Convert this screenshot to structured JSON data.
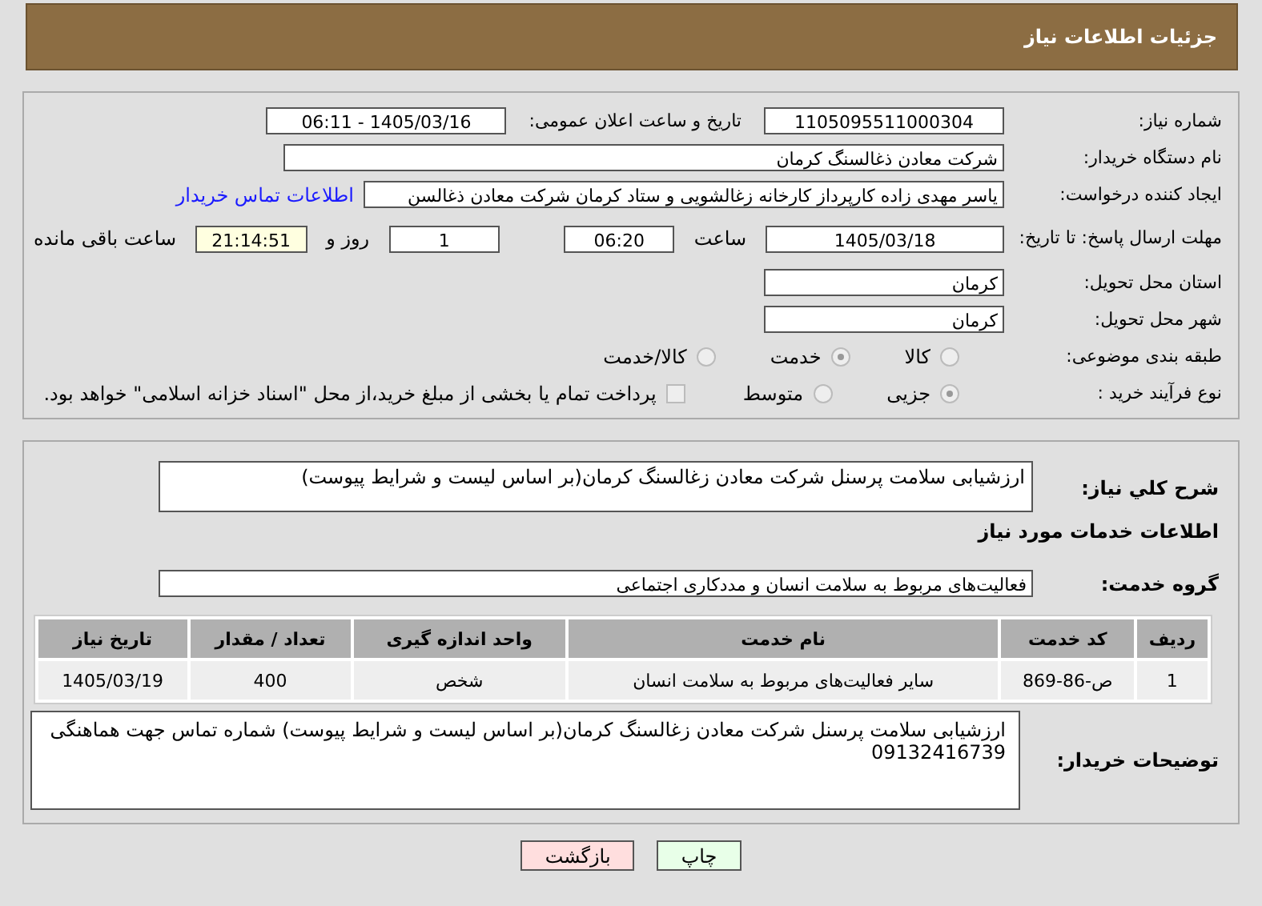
{
  "header": {
    "title": "جزئیات اطلاعات نیاز"
  },
  "details": {
    "need_number": {
      "label": "شماره نیاز:",
      "value": "1105095511000304"
    },
    "announce": {
      "label": "تاریخ و ساعت اعلان عمومی:",
      "value": "1405/03/16 - 06:11"
    },
    "buyer": {
      "label": "نام دستگاه خریدار:",
      "value": "شرکت معادن ذغالسنگ کرمان"
    },
    "creator": {
      "label": "ایجاد کننده درخواست:",
      "value": "یاسر مهدی زاده کارپرداز کارخانه زغالشویی و ستاد کرمان شرکت معادن ذغالسن",
      "link": "اطلاعات تماس خریدار"
    },
    "deadline": {
      "label": "مهلت ارسال پاسخ: تا تاریخ:",
      "date": "1405/03/18",
      "time_label": "ساعت",
      "time": "06:20",
      "days": "1",
      "days_label": "روز و",
      "remaining": "21:14:51",
      "remaining_label": "ساعت باقی مانده"
    },
    "province": {
      "label": "استان محل تحویل:",
      "value": "کرمان"
    },
    "city": {
      "label": "شهر محل تحویل:",
      "value": "کرمان"
    },
    "category": {
      "label": "طبقه بندی موضوعی:",
      "options": [
        {
          "label": "کالا",
          "selected": false
        },
        {
          "label": "خدمت",
          "selected": true
        },
        {
          "label": "کالا/خدمت",
          "selected": false
        }
      ]
    },
    "process": {
      "label": "نوع فرآیند خرید :",
      "options": [
        {
          "label": "جزیی",
          "selected": true
        },
        {
          "label": "متوسط",
          "selected": false
        }
      ],
      "payment": {
        "checked": false,
        "text": "پرداخت تمام یا بخشی از مبلغ خرید،از محل \"اسناد خزانه اسلامی\" خواهد بود."
      }
    }
  },
  "need": {
    "description_label": "شرح کلي نياز:",
    "description": "ارزشیابی سلامت پرسنل شرکت معادن زغالسنگ کرمان(بر اساس لیست و شرایط پیوست)",
    "services_title": "اطلاعات خدمات مورد نیاز",
    "group_label": "گروه خدمت:",
    "group": "فعالیت‌های مربوط به سلامت انسان و مددکاری اجتماعی",
    "table": {
      "columns": [
        "ردیف",
        "کد خدمت",
        "نام خدمت",
        "واحد اندازه گیری",
        "تعداد / مقدار",
        "تاریخ نیاز"
      ],
      "rows": [
        [
          "1",
          "ص-86-869",
          "سایر فعالیت‌های مربوط به سلامت انسان",
          "شخص",
          "400",
          "1405/03/19"
        ]
      ]
    },
    "notes_label": "توضیحات خریدار:",
    "notes": "ارزشیابی سلامت پرسنل شرکت معادن زغالسنگ کرمان(بر اساس لیست و شرایط پیوست) شماره تماس جهت هماهنگی 09132416739"
  },
  "buttons": [
    {
      "label": "چاپ",
      "kind": "print"
    },
    {
      "label": "بازگشت",
      "kind": "back"
    }
  ]
}
